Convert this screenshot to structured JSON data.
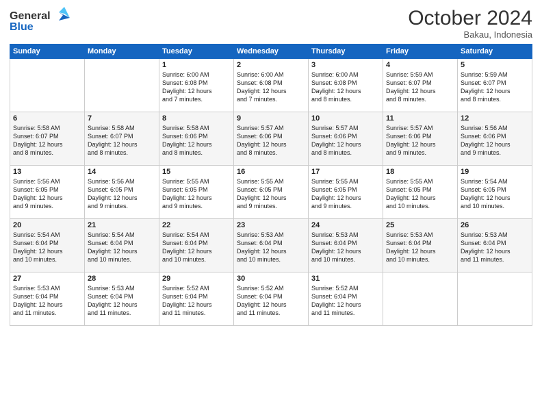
{
  "header": {
    "logo_line1": "General",
    "logo_line2": "Blue",
    "month": "October 2024",
    "location": "Bakau, Indonesia"
  },
  "weekdays": [
    "Sunday",
    "Monday",
    "Tuesday",
    "Wednesday",
    "Thursday",
    "Friday",
    "Saturday"
  ],
  "rows": [
    [
      {
        "day": "",
        "info": ""
      },
      {
        "day": "",
        "info": ""
      },
      {
        "day": "1",
        "info": "Sunrise: 6:00 AM\nSunset: 6:08 PM\nDaylight: 12 hours\nand 7 minutes."
      },
      {
        "day": "2",
        "info": "Sunrise: 6:00 AM\nSunset: 6:08 PM\nDaylight: 12 hours\nand 7 minutes."
      },
      {
        "day": "3",
        "info": "Sunrise: 6:00 AM\nSunset: 6:08 PM\nDaylight: 12 hours\nand 8 minutes."
      },
      {
        "day": "4",
        "info": "Sunrise: 5:59 AM\nSunset: 6:07 PM\nDaylight: 12 hours\nand 8 minutes."
      },
      {
        "day": "5",
        "info": "Sunrise: 5:59 AM\nSunset: 6:07 PM\nDaylight: 12 hours\nand 8 minutes."
      }
    ],
    [
      {
        "day": "6",
        "info": "Sunrise: 5:58 AM\nSunset: 6:07 PM\nDaylight: 12 hours\nand 8 minutes."
      },
      {
        "day": "7",
        "info": "Sunrise: 5:58 AM\nSunset: 6:07 PM\nDaylight: 12 hours\nand 8 minutes."
      },
      {
        "day": "8",
        "info": "Sunrise: 5:58 AM\nSunset: 6:06 PM\nDaylight: 12 hours\nand 8 minutes."
      },
      {
        "day": "9",
        "info": "Sunrise: 5:57 AM\nSunset: 6:06 PM\nDaylight: 12 hours\nand 8 minutes."
      },
      {
        "day": "10",
        "info": "Sunrise: 5:57 AM\nSunset: 6:06 PM\nDaylight: 12 hours\nand 8 minutes."
      },
      {
        "day": "11",
        "info": "Sunrise: 5:57 AM\nSunset: 6:06 PM\nDaylight: 12 hours\nand 9 minutes."
      },
      {
        "day": "12",
        "info": "Sunrise: 5:56 AM\nSunset: 6:06 PM\nDaylight: 12 hours\nand 9 minutes."
      }
    ],
    [
      {
        "day": "13",
        "info": "Sunrise: 5:56 AM\nSunset: 6:05 PM\nDaylight: 12 hours\nand 9 minutes."
      },
      {
        "day": "14",
        "info": "Sunrise: 5:56 AM\nSunset: 6:05 PM\nDaylight: 12 hours\nand 9 minutes."
      },
      {
        "day": "15",
        "info": "Sunrise: 5:55 AM\nSunset: 6:05 PM\nDaylight: 12 hours\nand 9 minutes."
      },
      {
        "day": "16",
        "info": "Sunrise: 5:55 AM\nSunset: 6:05 PM\nDaylight: 12 hours\nand 9 minutes."
      },
      {
        "day": "17",
        "info": "Sunrise: 5:55 AM\nSunset: 6:05 PM\nDaylight: 12 hours\nand 9 minutes."
      },
      {
        "day": "18",
        "info": "Sunrise: 5:55 AM\nSunset: 6:05 PM\nDaylight: 12 hours\nand 10 minutes."
      },
      {
        "day": "19",
        "info": "Sunrise: 5:54 AM\nSunset: 6:05 PM\nDaylight: 12 hours\nand 10 minutes."
      }
    ],
    [
      {
        "day": "20",
        "info": "Sunrise: 5:54 AM\nSunset: 6:04 PM\nDaylight: 12 hours\nand 10 minutes."
      },
      {
        "day": "21",
        "info": "Sunrise: 5:54 AM\nSunset: 6:04 PM\nDaylight: 12 hours\nand 10 minutes."
      },
      {
        "day": "22",
        "info": "Sunrise: 5:54 AM\nSunset: 6:04 PM\nDaylight: 12 hours\nand 10 minutes."
      },
      {
        "day": "23",
        "info": "Sunrise: 5:53 AM\nSunset: 6:04 PM\nDaylight: 12 hours\nand 10 minutes."
      },
      {
        "day": "24",
        "info": "Sunrise: 5:53 AM\nSunset: 6:04 PM\nDaylight: 12 hours\nand 10 minutes."
      },
      {
        "day": "25",
        "info": "Sunrise: 5:53 AM\nSunset: 6:04 PM\nDaylight: 12 hours\nand 10 minutes."
      },
      {
        "day": "26",
        "info": "Sunrise: 5:53 AM\nSunset: 6:04 PM\nDaylight: 12 hours\nand 11 minutes."
      }
    ],
    [
      {
        "day": "27",
        "info": "Sunrise: 5:53 AM\nSunset: 6:04 PM\nDaylight: 12 hours\nand 11 minutes."
      },
      {
        "day": "28",
        "info": "Sunrise: 5:53 AM\nSunset: 6:04 PM\nDaylight: 12 hours\nand 11 minutes."
      },
      {
        "day": "29",
        "info": "Sunrise: 5:52 AM\nSunset: 6:04 PM\nDaylight: 12 hours\nand 11 minutes."
      },
      {
        "day": "30",
        "info": "Sunrise: 5:52 AM\nSunset: 6:04 PM\nDaylight: 12 hours\nand 11 minutes."
      },
      {
        "day": "31",
        "info": "Sunrise: 5:52 AM\nSunset: 6:04 PM\nDaylight: 12 hours\nand 11 minutes."
      },
      {
        "day": "",
        "info": ""
      },
      {
        "day": "",
        "info": ""
      }
    ]
  ]
}
